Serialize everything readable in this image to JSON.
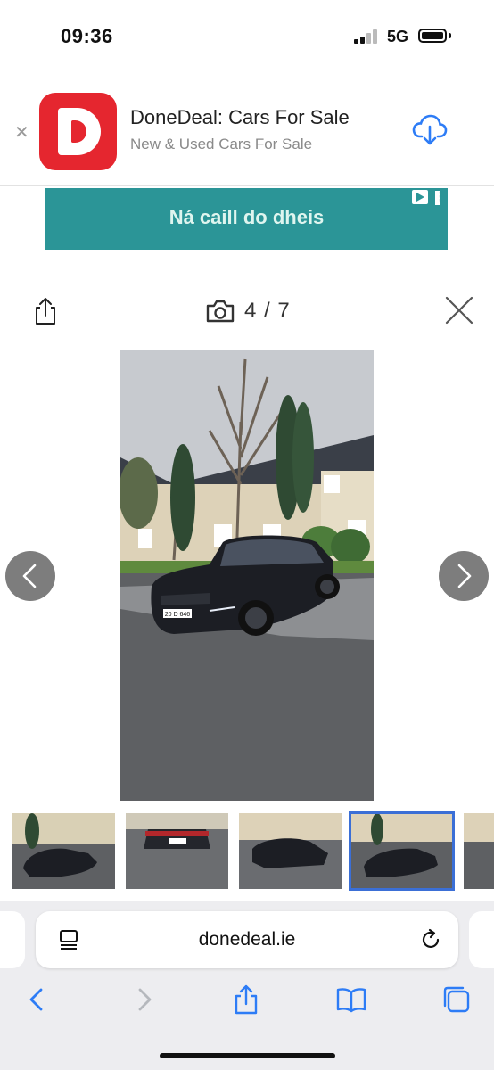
{
  "status_bar": {
    "time": "09:36",
    "network": "5G"
  },
  "app_banner": {
    "title": "DoneDeal: Cars For Sale",
    "subtitle": "New & Used Cars For Sale",
    "icon_letter": "D",
    "brand_color": "#e5262f"
  },
  "ad": {
    "text": "Ná caill do dheis",
    "background": "#2b9597"
  },
  "gallery": {
    "counter": "4 / 7",
    "current": 4,
    "total": 7,
    "plate_text": "20 D 646"
  },
  "browser": {
    "url": "donedeal.ie",
    "accent": "#2d7cf6"
  },
  "icons": [
    "close-icon",
    "download-icon",
    "ad-choices-icon",
    "share-icon",
    "camera-icon",
    "close-x-icon",
    "chevron-left-icon",
    "chevron-right-icon",
    "reader-icon",
    "reload-icon",
    "back-icon",
    "forward-icon",
    "bookmarks-icon",
    "tabs-icon"
  ]
}
